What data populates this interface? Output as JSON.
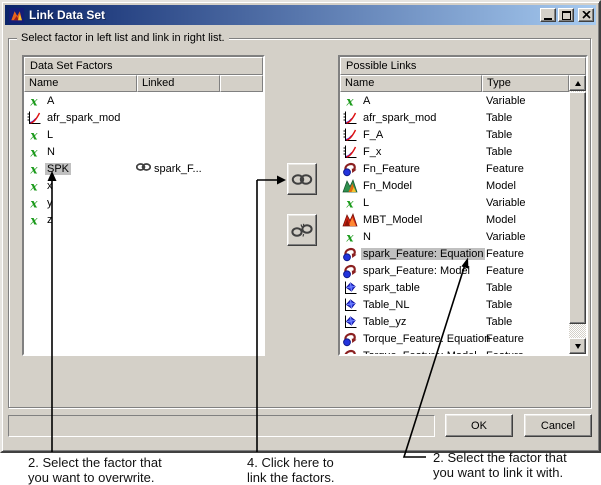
{
  "window": {
    "title": "Link Data Set",
    "icon": "matlab-logo",
    "controls": [
      "minimize",
      "maximize",
      "close"
    ]
  },
  "groupbox_label": "Select factor in left list and link in right list.",
  "left_panel": {
    "title": "Data Set Factors",
    "columns": [
      "Name",
      "Linked"
    ],
    "rows": [
      {
        "name": "A",
        "icon": "variable"
      },
      {
        "name": "afr_spark_mod",
        "icon": "table-curve"
      },
      {
        "name": "L",
        "icon": "variable"
      },
      {
        "name": "N",
        "icon": "variable"
      },
      {
        "name": "SPK",
        "icon": "variable",
        "selected": true,
        "linked": "spark_F...",
        "linked_icon": "chain-link"
      },
      {
        "name": "x",
        "icon": "variable"
      },
      {
        "name": "y",
        "icon": "variable"
      },
      {
        "name": "z",
        "icon": "variable"
      }
    ]
  },
  "right_panel": {
    "title": "Possible Links",
    "columns": [
      "Name",
      "Type"
    ],
    "rows": [
      {
        "name": "A",
        "type": "Variable",
        "icon": "variable"
      },
      {
        "name": "afr_spark_mod",
        "type": "Table",
        "icon": "table-curve"
      },
      {
        "name": "F_A",
        "type": "Table",
        "icon": "table-curve"
      },
      {
        "name": "F_x",
        "type": "Table",
        "icon": "table-curve"
      },
      {
        "name": "Fn_Feature",
        "type": "Feature",
        "icon": "feature"
      },
      {
        "name": "Fn_Model",
        "type": "Model",
        "icon": "model-green"
      },
      {
        "name": "L",
        "type": "Variable",
        "icon": "variable"
      },
      {
        "name": "MBT_Model",
        "type": "Model",
        "icon": "model-red"
      },
      {
        "name": "N",
        "type": "Variable",
        "icon": "variable"
      },
      {
        "name": "spark_Feature: Equation",
        "type": "Feature",
        "icon": "feature",
        "selected": true
      },
      {
        "name": "spark_Feature: Model",
        "type": "Feature",
        "icon": "feature"
      },
      {
        "name": "spark_table",
        "type": "Table",
        "icon": "table-surface"
      },
      {
        "name": "Table_NL",
        "type": "Table",
        "icon": "table-surface"
      },
      {
        "name": "Table_yz",
        "type": "Table",
        "icon": "table-surface"
      },
      {
        "name": "Torque_Feature: Equation",
        "type": "Feature",
        "icon": "feature"
      },
      {
        "name": "Torque_Feature: Model",
        "type": "Feature",
        "icon": "feature"
      }
    ]
  },
  "middle_buttons": [
    {
      "icon": "link-icon"
    },
    {
      "icon": "unlink-icon"
    }
  ],
  "action_buttons": {
    "ok": "OK",
    "cancel": "Cancel"
  },
  "annotations": {
    "overwrite": {
      "line1": "2. Select the factor that",
      "line2": "you want to overwrite."
    },
    "link_button": {
      "line1": "4. Click here to",
      "line2": "link the factors."
    },
    "link_with": {
      "line1": "2. Select the factor that",
      "line2": "you want to link it with."
    }
  },
  "colors": {
    "titlebar_start": "#0a246a",
    "titlebar_end": "#a6caf0",
    "dialog_bg": "#d4d0c8",
    "selection_bg": "#c0c0c0",
    "variable_green": "#1d9b1d"
  }
}
